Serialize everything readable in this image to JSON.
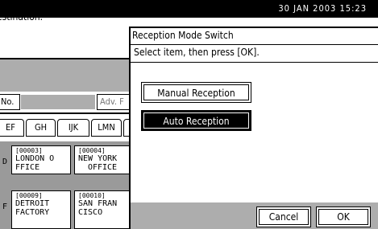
{
  "status_bar": {
    "clock": "30 JAN 2003 15:23"
  },
  "background": {
    "message": "estination.",
    "no_label": "No.",
    "adv_label": "Adv. F",
    "tabs": [
      "EF",
      "GH",
      "IJK",
      "LMN",
      ""
    ],
    "entries": [
      {
        "num": "[00003]",
        "name_line1": "LONDON O",
        "name_line2": "FFICE",
        "prefix": "D"
      },
      {
        "num": "[00004]",
        "name_line1": "NEW YORK",
        "name_line2": "OFFICE",
        "prefix": ""
      },
      {
        "num": "[00009]",
        "name_line1": "DETROIT",
        "name_line2": "FACTORY",
        "prefix": "F"
      },
      {
        "num": "[00010]",
        "name_line1": "SAN FRAN",
        "name_line2": "CISCO",
        "prefix": ""
      }
    ]
  },
  "dialog": {
    "title": "Reception Mode Switch",
    "instruction": "Select item, then press [OK].",
    "options": [
      "Manual Reception",
      "Auto Reception"
    ],
    "selected": "Auto Reception",
    "cancel_label": "Cancel",
    "ok_label": "OK"
  }
}
